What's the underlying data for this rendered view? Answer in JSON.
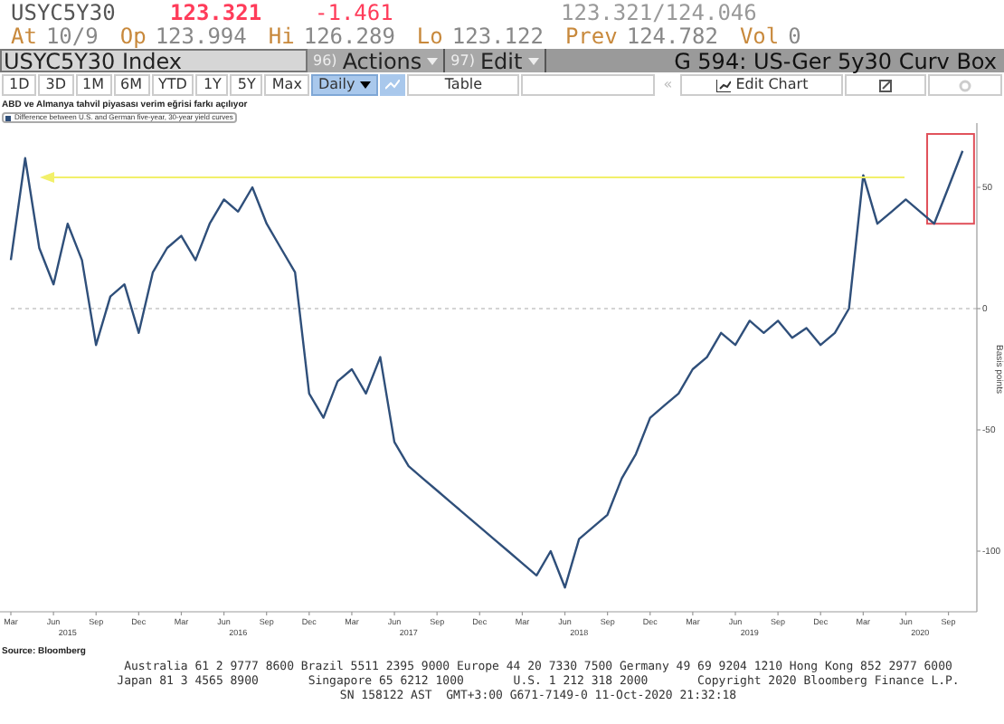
{
  "quote": {
    "ticker": "USYC5Y30",
    "last": "123.321",
    "change": "-1.461",
    "bid_ask": "123.321/124.046"
  },
  "stats": [
    {
      "label": "At",
      "value": "10/9"
    },
    {
      "label": "Op",
      "value": "123.994"
    },
    {
      "label": "Hi",
      "value": "126.289"
    },
    {
      "label": "Lo",
      "value": "123.122"
    },
    {
      "label": "Prev",
      "value": "124.782"
    },
    {
      "label": "Vol",
      "value": "0"
    }
  ],
  "toolbar": {
    "security": "USYC5Y30 Index",
    "menus": [
      {
        "number": "96)",
        "label": "Actions"
      },
      {
        "number": "97)",
        "label": "Edit"
      }
    ],
    "title": "G 594: US-Ger 5y30 Curv Box"
  },
  "controls": {
    "periods": [
      "1D",
      "3D",
      "1M",
      "6M",
      "YTD",
      "1Y",
      "5Y",
      "Max"
    ],
    "frequency": "Daily",
    "table": "Table",
    "collapse": "«",
    "edit_chart": "Edit Chart"
  },
  "chart": {
    "title": "ABD ve Almanya tahvil piyasası verim eğrisi farkı açılıyor",
    "years": [
      "2015",
      "2016",
      "2017",
      "2018",
      "2019",
      "2020"
    ],
    "chart_data": {
      "type": "line",
      "ylabel": "Basis points",
      "ylim": [
        -125,
        75
      ],
      "categories": [
        "Mar",
        null,
        null,
        "Jun",
        null,
        null,
        "Sep",
        null,
        null,
        "Dec",
        null,
        null,
        "Mar",
        null,
        null,
        "Jun",
        null,
        null,
        "Sep",
        null,
        null,
        "Dec",
        null,
        null,
        "Mar",
        null,
        null,
        "Jun",
        null,
        null,
        "Sep",
        null,
        null,
        "Dec",
        null,
        null,
        "Mar",
        null,
        null,
        "Jun",
        null,
        null,
        "Sep",
        null,
        null,
        "Dec",
        null,
        null,
        "Mar",
        null,
        null,
        "Jun",
        null,
        null,
        "Sep",
        null,
        null,
        "Dec",
        null,
        null,
        "Mar",
        null,
        null,
        "Jun",
        null,
        null,
        "Sep",
        null
      ],
      "series": [
        {
          "name": "Difference between U.S. and German five-year, 30-year yield curves",
          "color": "#2f4f7a",
          "values": [
            20,
            62,
            25,
            10,
            35,
            20,
            -15,
            5,
            10,
            -10,
            15,
            25,
            30,
            20,
            35,
            45,
            40,
            50,
            35,
            25,
            15,
            -35,
            -45,
            -30,
            -25,
            -35,
            -20,
            -55,
            -65,
            -70,
            -75,
            -80,
            -85,
            -90,
            -95,
            -100,
            -105,
            -110,
            -100,
            -115,
            -95,
            -90,
            -85,
            -70,
            -60,
            -45,
            -40,
            -35,
            -25,
            -20,
            -10,
            -15,
            -5,
            -10,
            -5,
            -12,
            -8,
            -15,
            -10,
            0,
            55,
            35,
            40,
            45,
            40,
            35,
            50,
            65
          ]
        }
      ],
      "yticks": [
        50,
        0,
        -50,
        -100
      ]
    },
    "source": "Source: Bloomberg"
  },
  "footer": [
    "Australia 61 2 9777 8600 Brazil 5511 2395 9000 Europe 44 20 7330 7500 Germany 49 69 9204 1210 Hong Kong 852 2977 6000",
    "Japan 81 3 4565 8900       Singapore 65 6212 1000       U.S. 1 212 318 2000       Copyright 2020 Bloomberg Finance L.P.",
    "SN 158122 AST  GMT+3:00 G671-7149-0 11-Oct-2020 21:32:18"
  ]
}
